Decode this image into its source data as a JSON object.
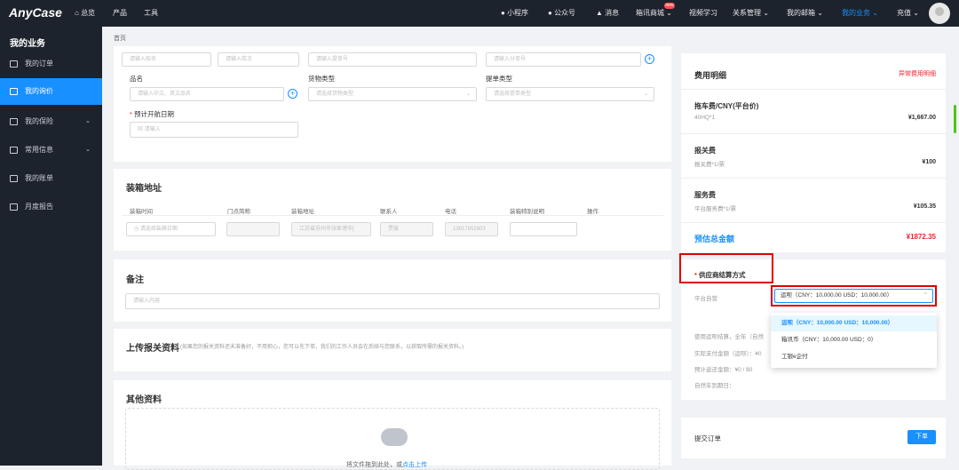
{
  "topbar": {
    "logo": "AnyCase",
    "nav_left": [
      "总览",
      "产品",
      "工具"
    ],
    "nav_right": [
      "小程序",
      "公众号",
      "消息",
      "箱讯商城",
      "视频学习",
      "关系管理",
      "我的邮箱",
      "我的业务",
      "充值"
    ],
    "mall_badge": "new"
  },
  "sidebar": {
    "title": "我的业务",
    "items": [
      {
        "label": "我的订单",
        "icon": "order-icon"
      },
      {
        "label": "我的询价",
        "icon": "inquiry-icon"
      },
      {
        "label": "我的保险",
        "icon": "insurance-icon"
      },
      {
        "label": "常用信息",
        "icon": "info-icon"
      },
      {
        "label": "我的账单",
        "icon": "bill-icon"
      },
      {
        "label": "月度报告",
        "icon": "report-icon"
      }
    ]
  },
  "breadcrumb": "首页",
  "form": {
    "row1_placeholders": [
      "请输入船名",
      "请输入航次",
      "请输入提单号",
      "请输入分单号"
    ],
    "product_label": "品名",
    "product_placeholder": "请输入中文、英文品名",
    "cargo_type_label": "货物类型",
    "cargo_type_placeholder": "请选择货物类型",
    "bl_type_label": "提单类型",
    "bl_type_placeholder": "请选择提单类型",
    "eta_label": "预计开航日期",
    "eta_placeholder": "请输入"
  },
  "loading": {
    "title": "装箱地址",
    "headers": [
      "装箱时间",
      "门点简称",
      "装箱地址",
      "联系人",
      "电话",
      "装箱特别说明",
      "操作"
    ],
    "date_placeholder": "请选择装箱日期",
    "address": "江苏省苏州市张家港市[",
    "contact": "贾骏",
    "phone": "13917852603"
  },
  "remarks": {
    "title": "备注",
    "placeholder": "请输入内容"
  },
  "upload": {
    "title": "上传报关资料",
    "note": "(如果您的报关资料还未准备好，不用担心，您可以先下单，我们的工作人员会在后续与您联系，以获取所需的报关资料。)"
  },
  "other": {
    "title": "其他资料",
    "drop_text": "将文件拖到此处，或",
    "drop_link": "点击上传"
  },
  "fees": {
    "title": "费用明细",
    "abnormal_link": "异常费用明细",
    "items": [
      {
        "name": "拖车费/CNY(平台价)",
        "detail": "40HQ*1",
        "amount": "¥1,667.00"
      },
      {
        "name": "报关费",
        "detail": "报关费*1/票",
        "amount": "¥100"
      },
      {
        "name": "服务费",
        "detail": "平台服务费*1/票",
        "amount": "¥105.35"
      }
    ],
    "total_label": "预估总金额",
    "total_amount": "¥1872.35"
  },
  "settlement": {
    "title": "供应商结算方式",
    "platform_label": "平台自营",
    "selected": "运呗（CNY：10,000.00 USD：10,000.00）",
    "options": [
      "运呗（CNY：10,000.00 USD：10,000.00）",
      "箱讯币（CNY：10,000.00 USD：0）",
      "工银e企付"
    ],
    "bg_lines": [
      "使用运呗结算，全年（自然",
      "实际支付金额（运呗）：¥0",
      "预计返还金额：¥0 / $0",
      "自然年到期日："
    ]
  },
  "submit": {
    "label": "提交订单",
    "button": "下单"
  },
  "colors": {
    "primary": "#1890ff",
    "danger": "#f5222d",
    "dark": "#1d232c"
  }
}
